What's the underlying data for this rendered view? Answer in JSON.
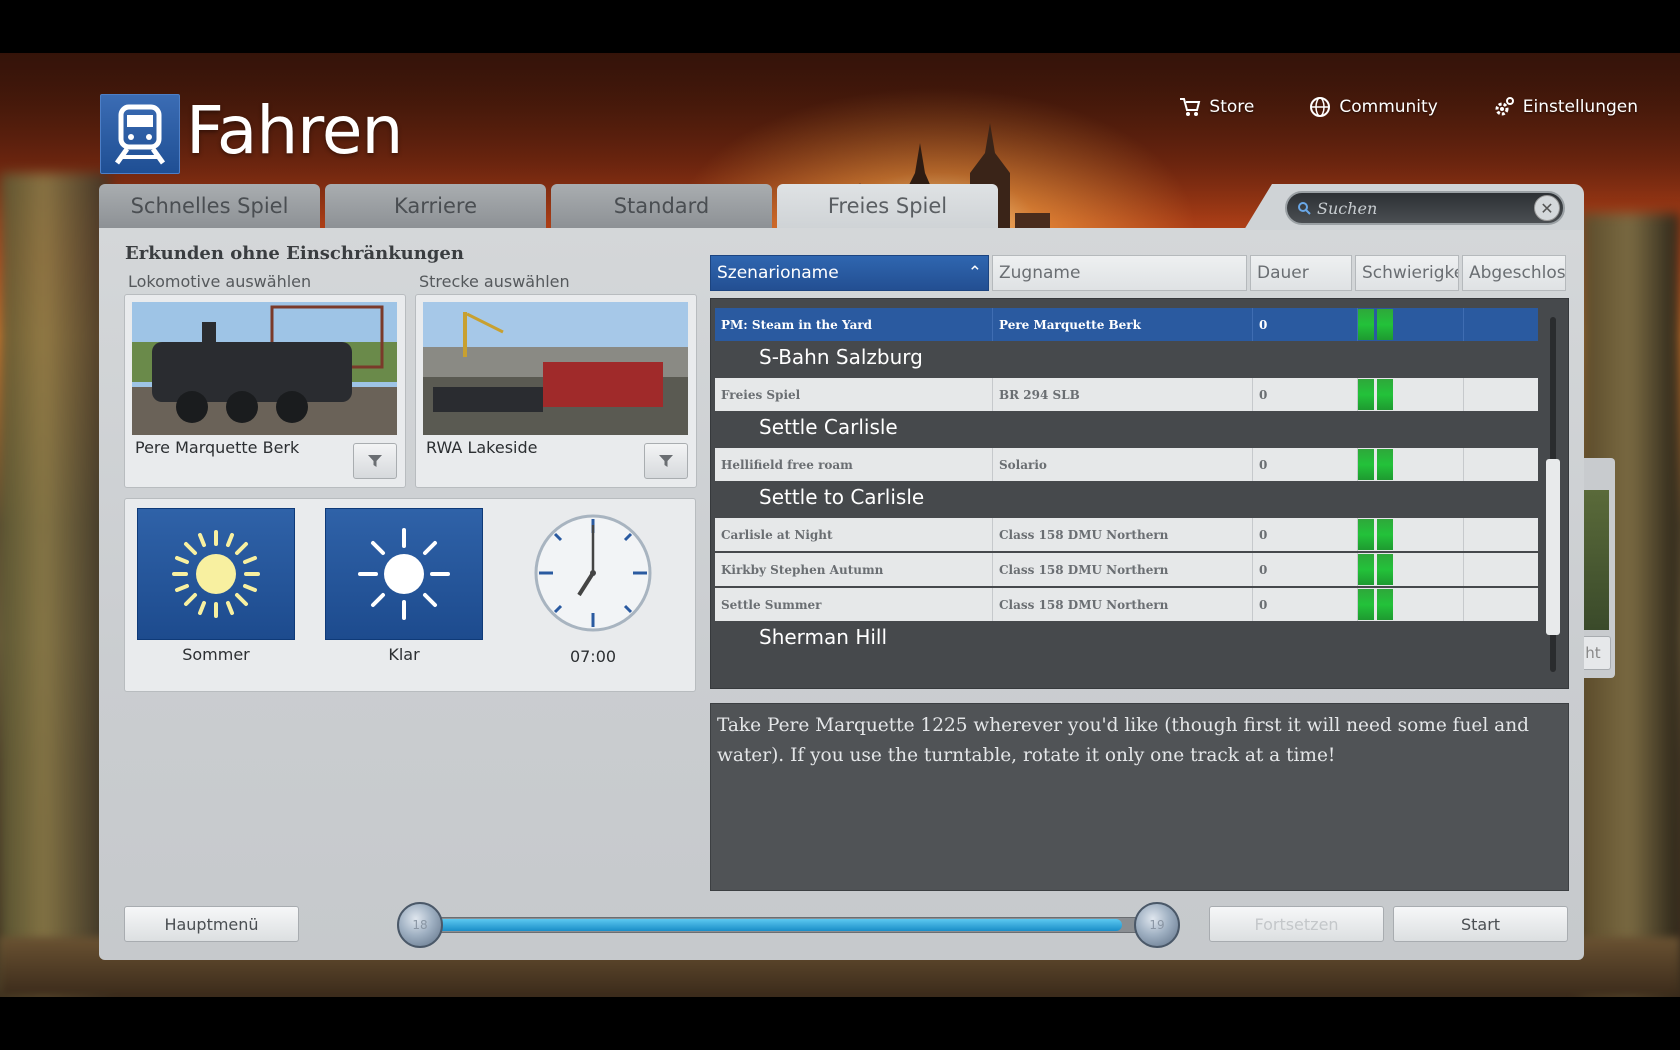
{
  "header": {
    "title": "Fahren",
    "links": [
      {
        "label": "Store",
        "icon": "cart-icon"
      },
      {
        "label": "Community",
        "icon": "globe-icon"
      },
      {
        "label": "Einstellungen",
        "icon": "gear-icon"
      }
    ]
  },
  "tabs": [
    {
      "label": "Schnelles Spiel",
      "active": false
    },
    {
      "label": "Karriere",
      "active": false
    },
    {
      "label": "Standard",
      "active": false
    },
    {
      "label": "Freies Spiel",
      "active": true
    }
  ],
  "search": {
    "placeholder": "Suchen"
  },
  "left": {
    "section_title": "Erkunden ohne Einschränkungen",
    "loco_label": "Lokomotive auswählen",
    "loco_name": "Pere Marquette Berk",
    "route_label": "Strecke auswählen",
    "route_name": "RWA Lakeside",
    "season": "Sommer",
    "weather": "Klar",
    "time": "07:00"
  },
  "table": {
    "columns": [
      "Szenarioname",
      "Zugname",
      "Dauer",
      "Schwierigke",
      "Abgeschlos"
    ],
    "selected_row": {
      "scenario": "PM: Steam in the Yard",
      "train": "Pere Marquette Berk",
      "duration": "0"
    },
    "groups": [
      {
        "name": "S-Bahn Salzburg",
        "rows": [
          {
            "scenario": "Freies Spiel",
            "train": "BR 294 SLB",
            "duration": "0"
          }
        ]
      },
      {
        "name": "Settle Carlisle",
        "rows": [
          {
            "scenario": "Hellifield free roam",
            "train": "Solario",
            "duration": "0"
          }
        ]
      },
      {
        "name": "Settle to Carlisle",
        "rows": [
          {
            "scenario": "Carlisle at Night",
            "train": "Class 158 DMU Northern",
            "duration": "0"
          },
          {
            "scenario": "Kirkby Stephen Autumn",
            "train": "Class 158 DMU Northern",
            "duration": "0"
          },
          {
            "scenario": "Settle Summer",
            "train": "Class 158 DMU Northern",
            "duration": "0"
          }
        ]
      },
      {
        "name": "Sherman Hill",
        "rows": []
      }
    ]
  },
  "description": "Take Pere Marquette 1225 wherever you'd like (though first it will need some fuel and water). If you use the turntable, rotate it only one track at a time!",
  "side_peek_label": "ht",
  "footer": {
    "main_menu": "Hauptmenü",
    "continue": "Fortsetzen",
    "start": "Start",
    "slider_left": "18",
    "slider_right": "19",
    "slider_fill_percent": 95
  },
  "colors": {
    "accent_blue": "#2a5aa0",
    "difficulty_green": "#23c23a",
    "slider_blue": "#1a8ec8"
  }
}
